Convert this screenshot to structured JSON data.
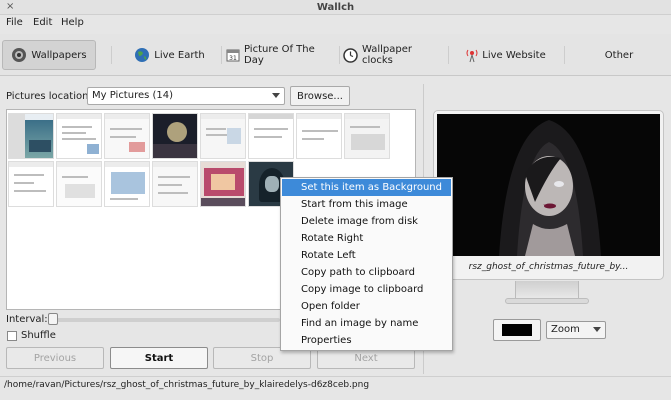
{
  "window": {
    "title": "Wallch",
    "close_glyph": "×"
  },
  "menubar": {
    "items": [
      "File",
      "Edit",
      "Help"
    ]
  },
  "tabs": [
    {
      "label": "Wallpapers",
      "icon": "camera-icon"
    },
    {
      "label": "Live Earth",
      "icon": "globe-icon"
    },
    {
      "label": "Picture Of The Day",
      "icon": "calendar-icon"
    },
    {
      "label": "Wallpaper clocks",
      "icon": "clock-icon"
    },
    {
      "label": "Live Website",
      "icon": "broadcast-icon"
    },
    {
      "label": "Other",
      "icon": ""
    }
  ],
  "wallpapers": {
    "location_label": "Pictures location:",
    "location_value": "My Pictures (14)",
    "browse_label": "Browse...",
    "interval_label": "Interval:",
    "interval_level": 0.0,
    "shuffle_label": "Shuffle",
    "shuffle_checked": false,
    "buttons": {
      "previous": "Previous",
      "start": "Start",
      "stop": "Stop",
      "next": "Next"
    }
  },
  "context_menu": {
    "items": [
      "Set this item as Background",
      "Start from this image",
      "Delete image from disk",
      "Rotate Right",
      "Rotate Left",
      "Copy path to clipboard",
      "Copy image to clipboard",
      "Open folder",
      "Find an image by name",
      "Properties"
    ],
    "highlighted_index": 0
  },
  "preview": {
    "caption": "rsz_ghost_of_christmas_future_by...",
    "background_color": "#000000",
    "style_value": "Zoom"
  },
  "status": {
    "path": "/home/ravan/Pictures/rsz_ghost_of_christmas_future_by_klairedelys-d6z8ceb.png"
  },
  "colors": {
    "highlight": "#3d8ad9",
    "window_bg": "#e6e6e6"
  }
}
